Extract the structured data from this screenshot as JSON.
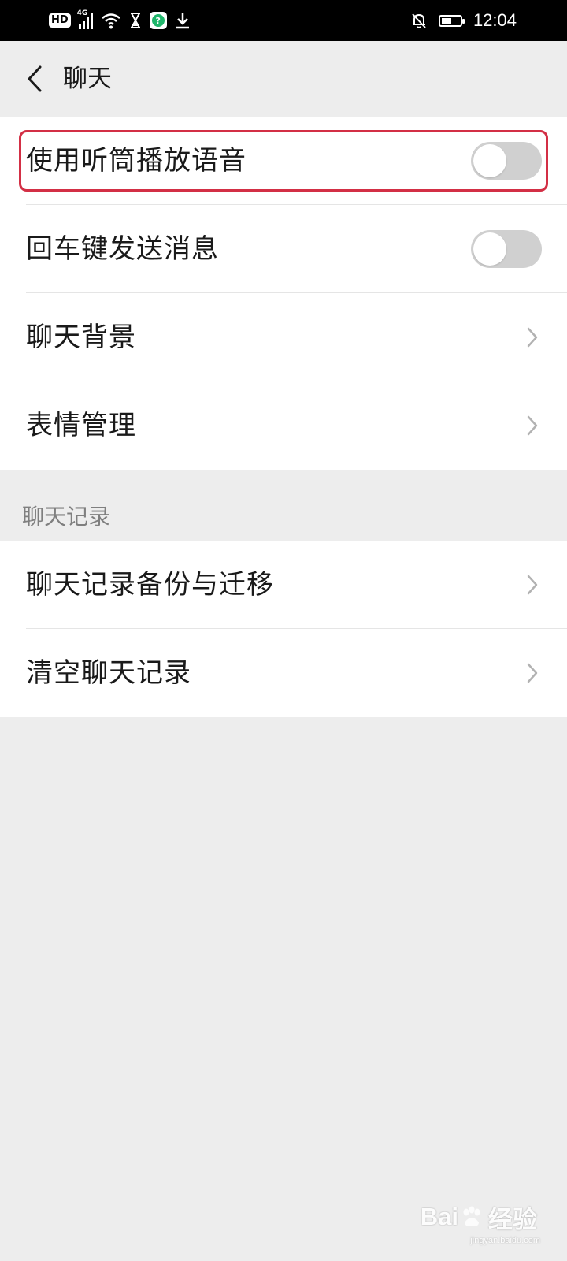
{
  "status_bar": {
    "hd_badge": "HD",
    "network_type": "4G",
    "time": "12:04",
    "battery_level": 0.55,
    "icons": [
      "hd-icon",
      "signal-icon",
      "wifi-icon",
      "hourglass-icon",
      "app-notification-icon",
      "download-icon",
      "notifications-muted-icon",
      "battery-icon"
    ]
  },
  "header": {
    "title": "聊天",
    "back_icon": "back-arrow-icon"
  },
  "settings": [
    {
      "label": "使用听筒播放语音",
      "control": "toggle",
      "on": false,
      "highlighted": true
    },
    {
      "label": "回车键发送消息",
      "control": "toggle",
      "on": false
    },
    {
      "label": "聊天背景",
      "control": "chevron"
    },
    {
      "label": "表情管理",
      "control": "chevron"
    }
  ],
  "chat_history": {
    "section_title": "聊天记录",
    "items": [
      {
        "label": "聊天记录备份与迁移",
        "control": "chevron"
      },
      {
        "label": "清空聊天记录",
        "control": "chevron"
      }
    ]
  },
  "watermark": {
    "brand_a": "Bai",
    "brand_b": "经验",
    "sub": "jingyan.baidu.com"
  },
  "colors": {
    "background": "#ededed",
    "card": "#ffffff",
    "toggle_off": "#d0d0d0",
    "highlight_border": "#d32f45",
    "status_bar": "#000000"
  }
}
